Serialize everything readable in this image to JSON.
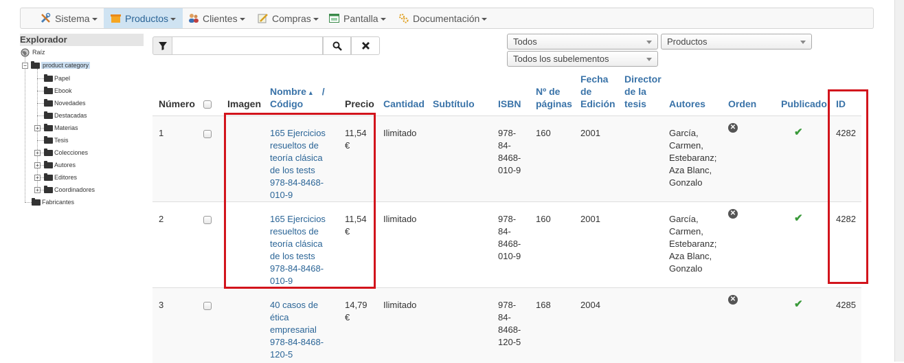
{
  "menu": [
    {
      "label": "Sistema",
      "icon": "tools-icon"
    },
    {
      "label": "Productos",
      "icon": "box-icon",
      "active": true
    },
    {
      "label": "Clientes",
      "icon": "users-icon"
    },
    {
      "label": "Compras",
      "icon": "pencil-paper-icon"
    },
    {
      "label": "Pantalla",
      "icon": "window-icon"
    },
    {
      "label": "Documentación",
      "icon": "gears-icon"
    }
  ],
  "explorer": {
    "title": "Explorador",
    "root": "Raíz",
    "category": "product category",
    "children": [
      "Papel",
      "Ebook",
      "Novedades",
      "Destacadas",
      "Materias",
      "Tesis",
      "Colecciones",
      "Autores",
      "Editores",
      "Coordinadores"
    ],
    "expandable": [
      false,
      false,
      false,
      false,
      true,
      false,
      true,
      true,
      true,
      true
    ],
    "other": "Fabricantes"
  },
  "filters": {
    "search_value": "",
    "select1": "Todos",
    "select2": "Productos",
    "select3": "Todos los subelementos"
  },
  "columns": {
    "numero": "Número",
    "imagen": "Imagen",
    "nombre": "Nombre",
    "nombre_sep": "/",
    "codigo": "Código",
    "precio": "Precio",
    "cantidad": "Cantidad",
    "subtitulo": "Subtítulo",
    "isbn": "ISBN",
    "paginas_1": "Nº de",
    "paginas_2": "páginas",
    "fecha_1": "Fecha",
    "fecha_2": "de",
    "fecha_3": "Edición",
    "director_1": "Director",
    "director_2": "de la",
    "director_3": "tesis",
    "autores": "Autores",
    "orden": "Orden",
    "publicado": "Publicado",
    "id": "ID"
  },
  "rows": [
    {
      "num": "1",
      "name_lines": [
        "165 Ejercicios",
        "resueltos de",
        "teoría clásica",
        "de los tests",
        "978-84-8468-",
        "010-9"
      ],
      "price_lines": [
        "11,54",
        "€"
      ],
      "cantidad": "Ilimitado",
      "isbn_lines": [
        "978-",
        "84-",
        "8468-",
        "010-9"
      ],
      "paginas": "160",
      "fecha": "2001",
      "autores_lines": [
        "García,",
        "Carmen,",
        "Estebaranz;",
        "Aza Blanc,",
        "Gonzalo"
      ],
      "id": "4282"
    },
    {
      "num": "2",
      "name_lines": [
        "165 Ejercicios",
        "resueltos de",
        "teoría clásica",
        "de los tests",
        "978-84-8468-",
        "010-9"
      ],
      "price_lines": [
        "11,54",
        "€"
      ],
      "cantidad": "Ilimitado",
      "isbn_lines": [
        "978-",
        "84-",
        "8468-",
        "010-9"
      ],
      "paginas": "160",
      "fecha": "2001",
      "autores_lines": [
        "García,",
        "Carmen,",
        "Estebaranz;",
        "Aza Blanc,",
        "Gonzalo"
      ],
      "id": "4282"
    },
    {
      "num": "3",
      "name_lines": [
        "40 casos de",
        "ética",
        "empresarial",
        "978-84-8468-",
        "120-5"
      ],
      "price_lines": [
        "14,79",
        "€"
      ],
      "cantidad": "Ilimitado",
      "isbn_lines": [
        "978-",
        "84-",
        "8468-",
        "120-5"
      ],
      "paginas": "168",
      "fecha": "2004",
      "autores_lines": [],
      "id": "4285"
    }
  ],
  "colors": {
    "link": "#2a6496",
    "highlight": "#d2141c",
    "published": "#3a9a3a"
  }
}
